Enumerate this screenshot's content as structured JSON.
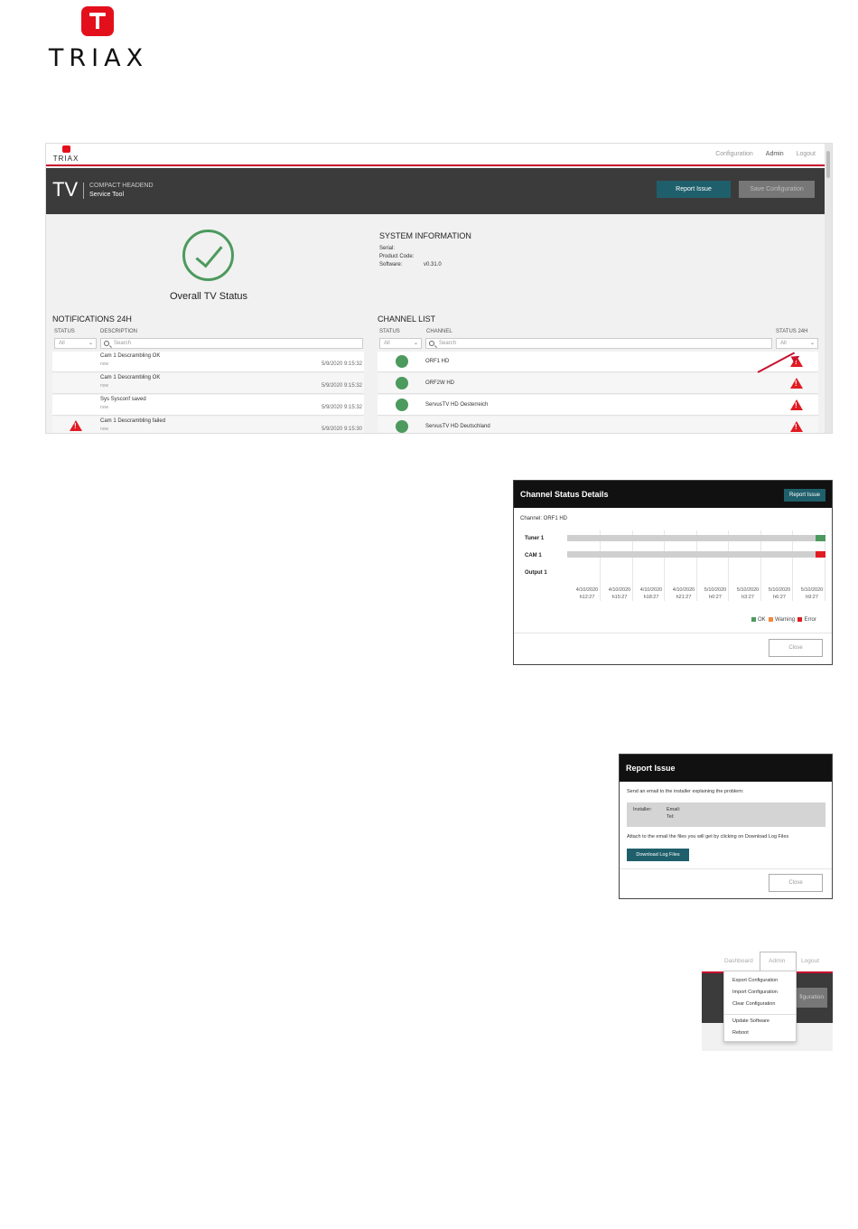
{
  "logo": {
    "wordmark": "TRIAX",
    "brand_color": "#e3101c"
  },
  "dashboard": {
    "top_logo": "TRIAX",
    "nav": [
      "Configuration",
      "Admin",
      "Logout"
    ],
    "header": {
      "tv": "TV",
      "line1": "COMPACT HEADEND",
      "line2": "Service Tool"
    },
    "buttons": {
      "report": "Report Issue",
      "save": "Save Configuration"
    },
    "overall_status": "Overall TV Status",
    "system_info": {
      "title": "SYSTEM INFORMATION",
      "serial_label": "Serial:",
      "product_code_label": "Product Code:",
      "software_label": "Software:",
      "software_value": "v0.31.0"
    },
    "notifications": {
      "title": "NOTIFICATIONS 24H",
      "col_status": "STATUS",
      "col_description": "DESCRIPTION",
      "filter_value": "All",
      "search_placeholder": "Search",
      "rows": [
        {
          "desc": "Cam 1 Descrambling OK",
          "sub": "now",
          "time": "5/9/2020 9:15:32",
          "warning": false
        },
        {
          "desc": "Cam 1 Descrambling OK",
          "sub": "now",
          "time": "5/9/2020 9:15:32",
          "warning": false
        },
        {
          "desc": "Sys Sysconf saved",
          "sub": "now",
          "time": "5/9/2020 9:15:32",
          "warning": false
        },
        {
          "desc": "Cam 1 Descrambling failed",
          "sub": "now",
          "time": "5/9/2020 9:15:30",
          "warning": true
        }
      ]
    },
    "channels": {
      "title": "CHANNEL LIST",
      "col_status": "STATUS",
      "col_channel": "CHANNEL",
      "col_status24": "STATUS 24H",
      "filter_value": "All",
      "filter24_value": "All",
      "search_placeholder": "Search",
      "rows": [
        {
          "name": "ORF1 HD"
        },
        {
          "name": "ORF2W HD"
        },
        {
          "name": "ServusTV HD Oesterreich"
        },
        {
          "name": "ServusTV HD Deutschland"
        }
      ]
    },
    "colors": {
      "accent": "#1f5f6b",
      "ok": "#4c9a5d",
      "error": "#e11b22",
      "header": "#3b3b3b"
    }
  },
  "channel_details": {
    "title": "Channel Status Details",
    "report_button": "Report Issue",
    "channel_label": "Channel: ORF1 HD",
    "rows": [
      "Tuner 1",
      "CAM 1",
      "Output 1"
    ],
    "ticks": [
      {
        "date": "4/10/2020",
        "time": "h12:27"
      },
      {
        "date": "4/10/2020",
        "time": "h15:27"
      },
      {
        "date": "4/10/2020",
        "time": "h18:27"
      },
      {
        "date": "4/10/2020",
        "time": "h21:27"
      },
      {
        "date": "5/10/2020",
        "time": "h0:27"
      },
      {
        "date": "5/10/2020",
        "time": "h3:27"
      },
      {
        "date": "5/10/2020",
        "time": "h6:27"
      },
      {
        "date": "5/10/2020",
        "time": "h9:27"
      }
    ],
    "legend": {
      "ok": "OK",
      "warning": "Warning",
      "error": "Error"
    },
    "close": "Close"
  },
  "report_issue": {
    "title": "Report Issue",
    "intro": "Send an email to the installer explaining the problem:",
    "installer_label": "Installer:",
    "email_label": "Email:",
    "tel_label": "Tel:",
    "attach_text": "Attach to the email the files you will get by clicking on Download Log Files",
    "download_button": "Download Log Files",
    "close": "Close"
  },
  "admin_menu": {
    "nav": {
      "dashboard": "Dashboard",
      "admin": "Admin",
      "logout": "Logout"
    },
    "partial_button": "figuration",
    "items": [
      "Export Configuration",
      "Import Configuration",
      "Clear Configuration",
      "Update Software",
      "Reboot"
    ]
  }
}
